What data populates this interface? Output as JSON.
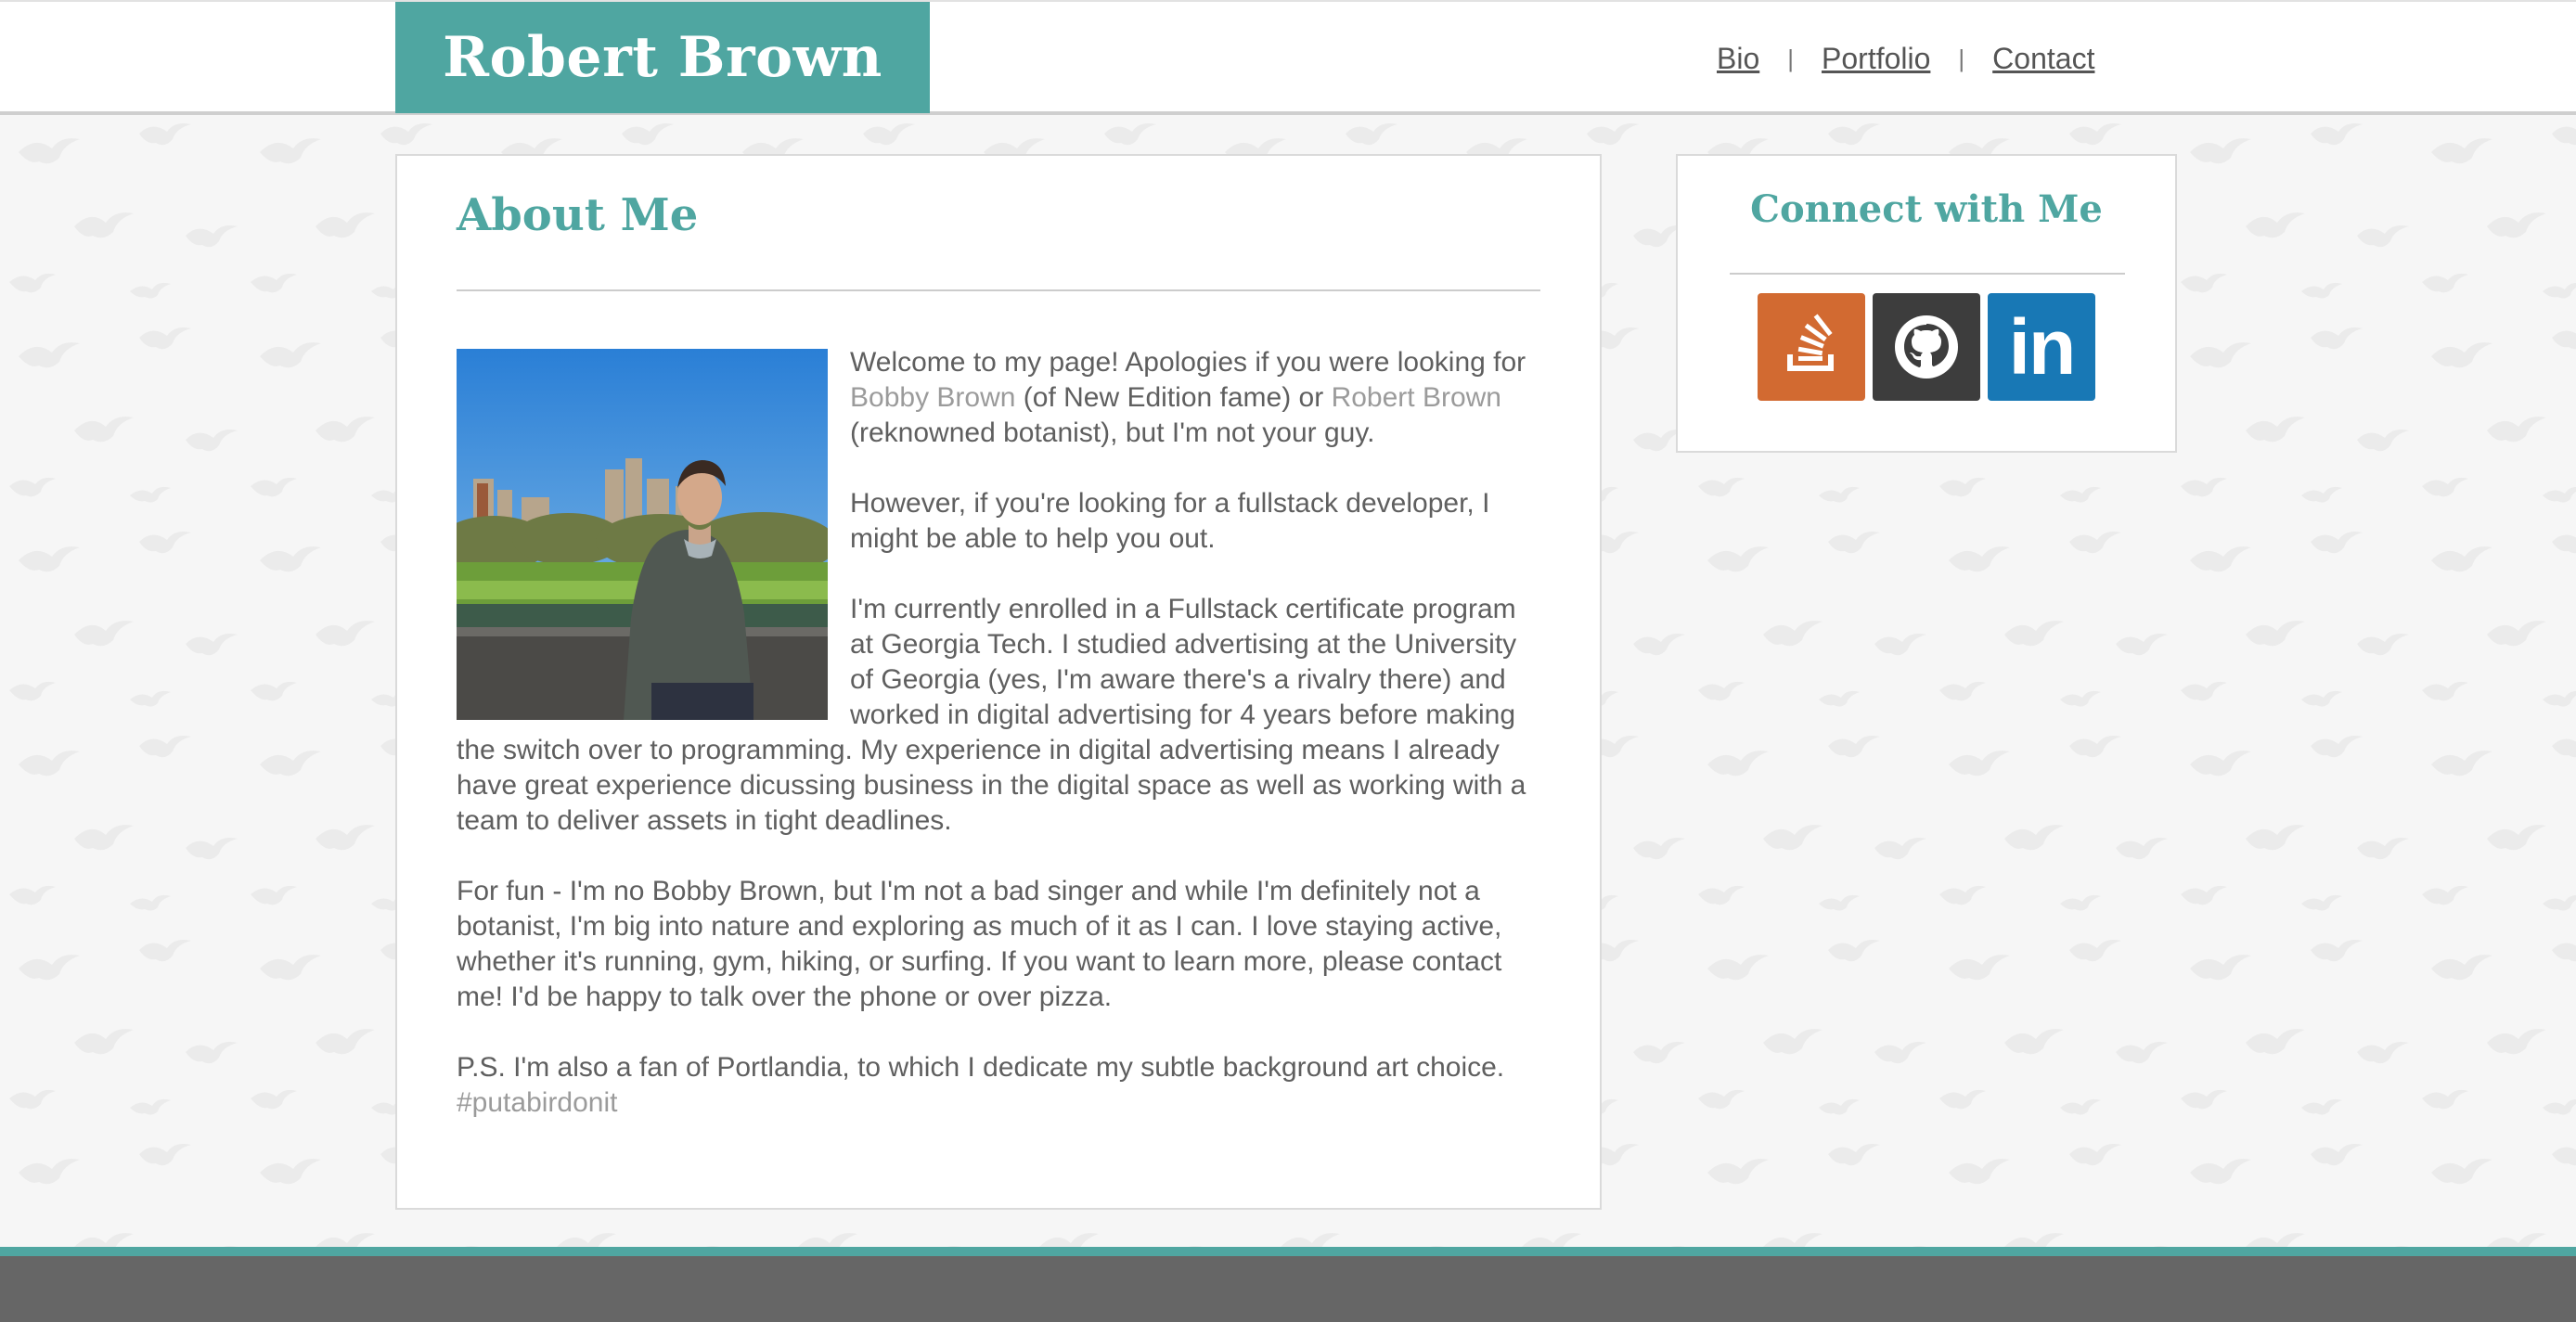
{
  "header": {
    "brand": "Robert Brown",
    "nav": [
      {
        "label": "Bio"
      },
      {
        "label": "Portfolio"
      },
      {
        "label": "Contact"
      }
    ],
    "separator": "|"
  },
  "about": {
    "title": "About Me",
    "p1": {
      "t1": "Welcome to my page! Apologies if you were looking for ",
      "link1": "Bobby Brown",
      "t2": " (of New Edition fame) or ",
      "link2": "Robert Brown",
      "t3": " (reknowned botanist), but I'm not your guy."
    },
    "p2": "However, if you're looking for a fullstack developer, I might be able to help you out.",
    "p3": "I'm currently enrolled in a Fullstack certificate program at Georgia Tech. I studied advertising at the University of Georgia (yes, I'm aware there's a rivalry there) and worked in digital advertising for 4 years before making the switch over to programming. My experience in digital advertising means I already have great experience dicussing business in the digital space as well as working with a team to deliver assets in tight deadlines.",
    "p4": "For fun - I'm no Bobby Brown, but I'm not a bad singer and while I'm definitely not a botanist, I'm big into nature and exploring as much of it as I can. I love staying active, whether it's running, gym, hiking, or surfing. If you want to learn more, please contact me! I'd be happy to talk over the phone or over pizza.",
    "p5": {
      "text": "P.S. I'm also a fan of Portlandia, to which I dedicate my subtle background art choice. ",
      "hashtag": "#putabirdonit"
    }
  },
  "connect": {
    "title": "Connect with Me",
    "links": [
      {
        "icon": "stackoverflow-icon",
        "color": "#d26a31"
      },
      {
        "icon": "github-icon",
        "color": "#3d3d3d"
      },
      {
        "icon": "linkedin-icon",
        "color": "#1878b5",
        "glyph": "in"
      }
    ]
  },
  "colors": {
    "accent": "#4fa6a1",
    "footer": "#666666",
    "text": "#5f5f5f"
  }
}
